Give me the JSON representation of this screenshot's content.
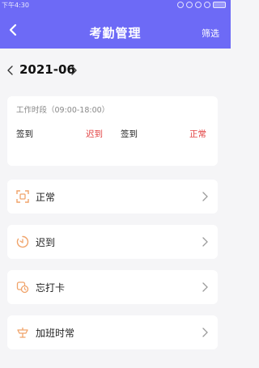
{
  "status_bar": {
    "time": "下午4:30"
  },
  "header": {
    "title": "考勤管理",
    "filter_label": "筛选",
    "background": "#6d6af6"
  },
  "month_selector": {
    "label": "2021-06"
  },
  "attendance_card": {
    "shift": "工作时段（09:00-18:00）",
    "checkins": [
      {
        "label": "签到",
        "status": "迟到"
      },
      {
        "label": "签到",
        "status": "正常"
      }
    ]
  },
  "categories": [
    {
      "label": "正常",
      "icon": "scan-frame-icon"
    },
    {
      "label": "迟到",
      "icon": "timer-icon"
    },
    {
      "label": "忘打卡",
      "icon": "missed-punch-icon"
    },
    {
      "label": "加班时常",
      "icon": "overtime-icon"
    }
  ],
  "colors": {
    "accent": "#6d6af6",
    "warning_text": "#e24040",
    "icon_orange": "#f0a36a"
  }
}
